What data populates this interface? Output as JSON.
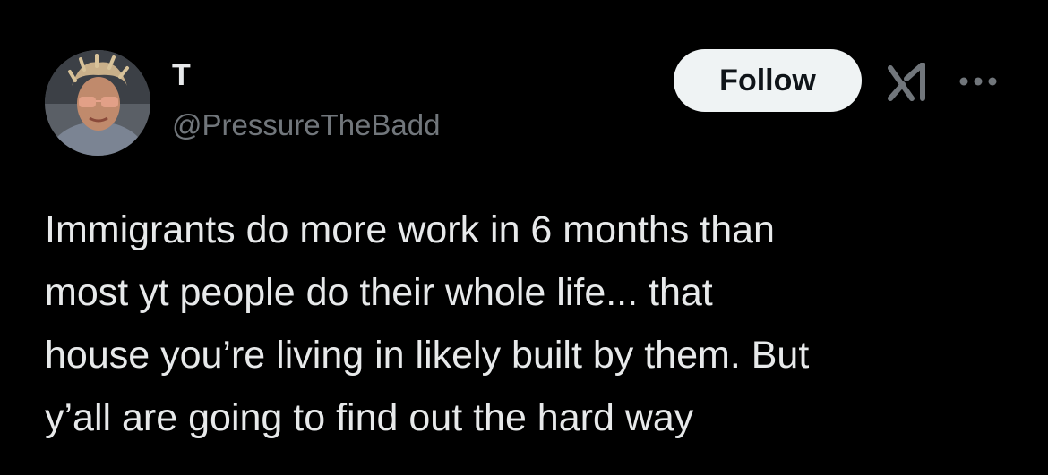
{
  "author": {
    "display_name": "T",
    "handle": "@PressureTheBadd",
    "avatar_alt": "avatar"
  },
  "actions": {
    "follow_label": "Follow",
    "grok_icon": "grok-icon",
    "more_icon": "more-options-icon"
  },
  "tweet": {
    "lines": [
      "Immigrants do more work in 6 months than",
      "most yt people do their whole life... that",
      "house you’re living in likely built by them. But",
      "y’all are going to find out the hard way"
    ]
  },
  "colors": {
    "background": "#000000",
    "text_primary": "#e7e9ea",
    "text_secondary": "#71767b",
    "follow_bg": "#eff3f4",
    "follow_text": "#0f1419"
  }
}
